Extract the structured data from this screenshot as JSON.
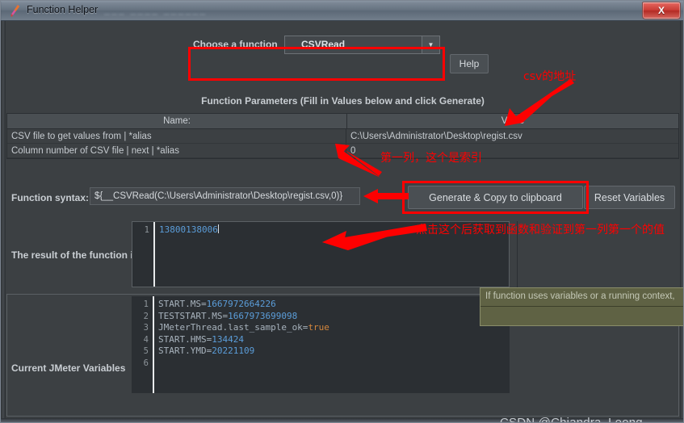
{
  "window": {
    "title": "Function Helper",
    "ghost_title": "___  ____  ______",
    "close_label": "X",
    "icon": "jmeter-feather-icon"
  },
  "choose": {
    "label": "Choose a function",
    "selected": "__CSVRead",
    "arrow_glyph": "▼",
    "help_label": "Help"
  },
  "parameters": {
    "title": "Function Parameters (Fill in Values below and click Generate)",
    "headers": [
      "Name:",
      "Value"
    ],
    "rows": [
      {
        "name": "CSV file to get values from | *alias",
        "value": "C:\\Users\\Administrator\\Desktop\\regist.csv"
      },
      {
        "name": "Column number of CSV file | next | *alias",
        "value": "0"
      }
    ]
  },
  "syntax": {
    "label": "Function syntax:",
    "value": "${__CSVRead(C:\\Users\\Administrator\\Desktop\\regist.csv,0)}",
    "generate_label": "Generate & Copy to clipboard",
    "reset_label": "Reset Variables"
  },
  "result": {
    "label": "The result of the function is",
    "line_numbers": [
      "1"
    ],
    "value": "13800138006"
  },
  "variables": {
    "label": "Current JMeter Variables",
    "line_numbers": [
      "1",
      "2",
      "3",
      "4",
      "5",
      "6"
    ],
    "entries": [
      {
        "key": "START.MS=",
        "value": "1667972664226",
        "type": "num"
      },
      {
        "key": "TESTSTART.MS=",
        "value": "1667973699098",
        "type": "num"
      },
      {
        "key": "JMeterThread.last_sample_ok=",
        "value": "true",
        "type": "bool"
      },
      {
        "key": "START.HMS=",
        "value": "134424",
        "type": "num"
      },
      {
        "key": "START.YMD=",
        "value": "20221109",
        "type": "num"
      }
    ]
  },
  "tooltip": {
    "text": "If function uses variables or a running context,"
  },
  "annotations": {
    "csv_address": "csv的地址",
    "first_column": "第一列，这个是索引",
    "click_result": "点击这个后获取到函数和验证到第一列第一个的值"
  },
  "watermark": {
    "text": "CSDN @Chiandra_Leong"
  },
  "colors": {
    "annotation_red": "#fe0000",
    "window_bg": "#3c4043",
    "editor_bg": "#2b2f33",
    "value_blue": "#5b9dd9",
    "bool_orange": "#d4863c",
    "tooltip_bg": "#5f6244"
  }
}
